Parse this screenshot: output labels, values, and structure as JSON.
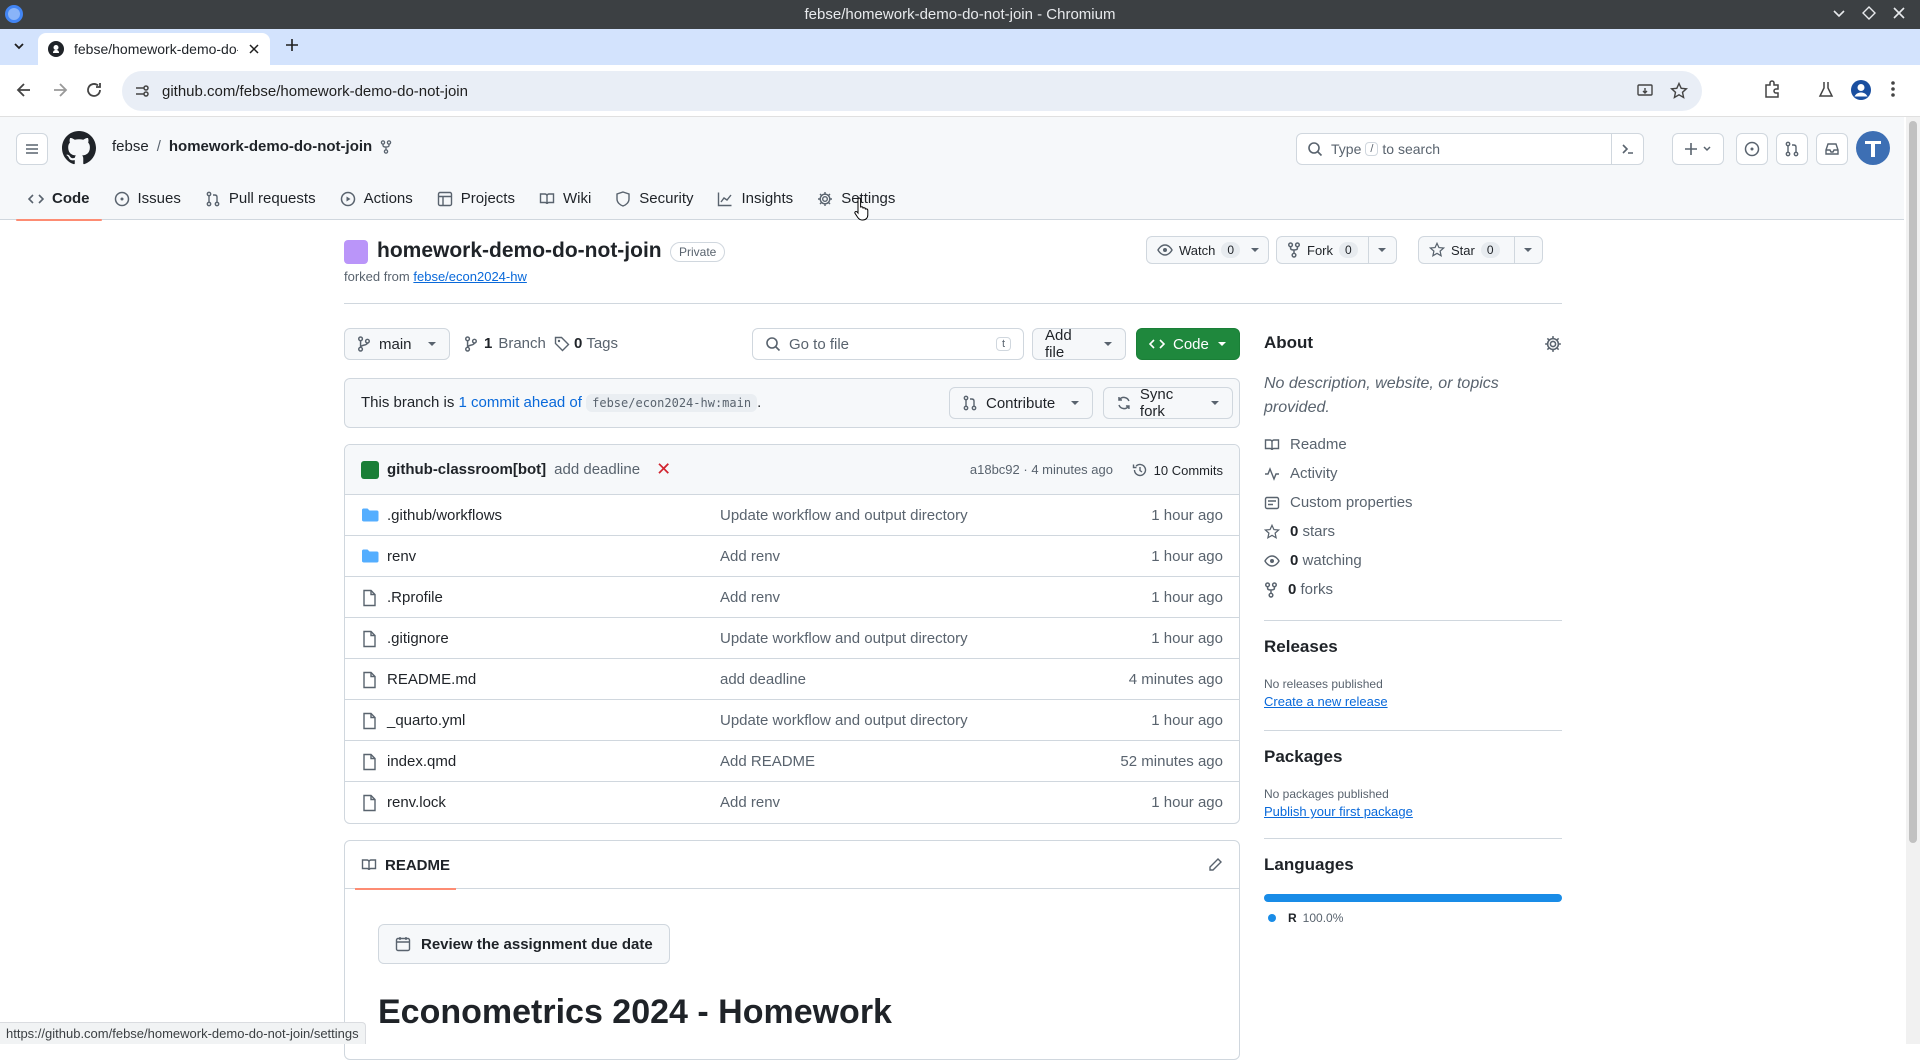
{
  "window": {
    "title": "febse/homework-demo-do-not-join - Chromium"
  },
  "browser": {
    "tab_title": "febse/homework-demo-do-not-join",
    "url": "github.com/febse/homework-demo-do-not-join",
    "status_url": "https://github.com/febse/homework-demo-do-not-join/settings"
  },
  "header": {
    "owner": "febse",
    "separator": "/",
    "repo": "homework-demo-do-not-join",
    "search_placeholder_pre": "Type",
    "search_key": "/",
    "search_placeholder_post": "to search"
  },
  "nav": {
    "code": "Code",
    "issues": "Issues",
    "pulls": "Pull requests",
    "actions": "Actions",
    "projects": "Projects",
    "wiki": "Wiki",
    "security": "Security",
    "insights": "Insights",
    "settings": "Settings"
  },
  "repo": {
    "name": "homework-demo-do-not-join",
    "visibility": "Private",
    "forked_from_label": "forked from",
    "forked_from": "febse/econ2024-hw",
    "watch_label": "Watch",
    "watch_count": "0",
    "fork_label": "Fork",
    "fork_count": "0",
    "star_label": "Star",
    "star_count": "0"
  },
  "filebar": {
    "branch": "main",
    "branches_count": "1",
    "branches_label": "Branch",
    "tags_count": "0",
    "tags_label": "Tags",
    "goto_placeholder": "Go to file",
    "goto_key": "t",
    "add_file": "Add file",
    "code_button": "Code"
  },
  "branch_info": {
    "prefix": "This branch is",
    "ahead": "1 commit ahead of",
    "ref": "febse/econ2024-hw:main",
    "suffix": ".",
    "contribute": "Contribute",
    "sync": "Sync fork"
  },
  "last_commit": {
    "author": "github-classroom[bot]",
    "message": "add deadline",
    "status": "✕",
    "sha_time": "a18bc92 · 4 minutes ago",
    "commits": "10 Commits"
  },
  "files": [
    {
      "name": ".github/workflows",
      "type": "dir",
      "message": "Update workflow and output directory",
      "date": "1 hour ago"
    },
    {
      "name": "renv",
      "type": "dir",
      "message": "Add renv",
      "date": "1 hour ago"
    },
    {
      "name": ".Rprofile",
      "type": "file",
      "message": "Add renv",
      "date": "1 hour ago"
    },
    {
      "name": ".gitignore",
      "type": "file",
      "message": "Update workflow and output directory",
      "date": "1 hour ago"
    },
    {
      "name": "README.md",
      "type": "file",
      "message": "add deadline",
      "date": "4 minutes ago"
    },
    {
      "name": "_quarto.yml",
      "type": "file",
      "message": "Update workflow and output directory",
      "date": "1 hour ago"
    },
    {
      "name": "index.qmd",
      "type": "file",
      "message": "Add README",
      "date": "52 minutes ago"
    },
    {
      "name": "renv.lock",
      "type": "file",
      "message": "Add renv",
      "date": "1 hour ago"
    }
  ],
  "readme": {
    "tab": "README",
    "due_button": "Review the assignment due date",
    "heading": "Econometrics 2024 - Homework"
  },
  "about": {
    "title": "About",
    "description": "No description, website, or topics provided.",
    "readme": "Readme",
    "activity": "Activity",
    "custom_properties": "Custom properties",
    "stars_count": "0",
    "stars_label": "stars",
    "watching_count": "0",
    "watching_label": "watching",
    "forks_count": "0",
    "forks_label": "forks"
  },
  "releases": {
    "title": "Releases",
    "none": "No releases published",
    "create": "Create a new release"
  },
  "packages": {
    "title": "Packages",
    "none": "No packages published",
    "publish": "Publish your first package"
  },
  "languages": {
    "title": "Languages",
    "name": "R",
    "percent": "100.0%",
    "share": 1.0,
    "color": "#198ce7"
  }
}
